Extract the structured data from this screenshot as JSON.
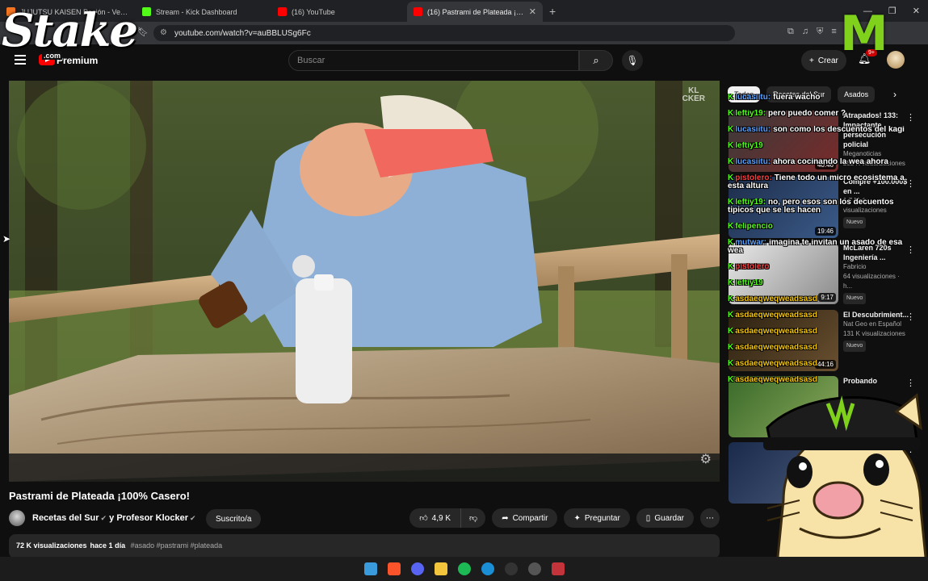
{
  "browser": {
    "tabs": [
      {
        "title": "JUJUTSU KAISEN Pasión - Ver en Crunchyroll",
        "color": "#f47521"
      },
      {
        "title": "Stream - Kick Dashboard",
        "color": "#53fc18"
      },
      {
        "title": "(16) YouTube",
        "color": "#ff0000"
      },
      {
        "title": "(16) Pastrami de Plateada ¡100% Casero! - YouTube",
        "color": "#ff0000"
      }
    ],
    "url": "youtube.com/watch?v=auBBLUSg6Fc",
    "new_tab": "+",
    "close": "✕"
  },
  "overlay": {
    "stake_logo": "Stake",
    "stake_com": ".com",
    "monster_logo": "M"
  },
  "header": {
    "premium_label": "Premium",
    "search_placeholder": "Buscar",
    "create_label": "Crear",
    "notifications_badge": "9+"
  },
  "video": {
    "title": "Pastrami de Plateada ¡100% Casero!",
    "watermark_line1": "KL",
    "watermark_line2": "CKER",
    "channel": "Recetas del Sur",
    "channel_joiner": "y",
    "channel2": "Profesor Klocker",
    "subscribe_label": "Suscrito/a",
    "likes": "4,9 K",
    "share_label": "Compartir",
    "ask_label": "Preguntar",
    "save_label": "Guardar",
    "views": "72 K visualizaciones",
    "age": "hace 1 día",
    "tags": "#asado #pastrami #plateada"
  },
  "sidebar": {
    "chips": [
      "Todos",
      "Recetas del Sur",
      "Asados"
    ],
    "recommendations": [
      {
        "title": "Atrapados! 133: Impactante persecución policial",
        "channel": "Meganoticias",
        "views": "252 K visualizaciones",
        "badge": "",
        "duration": "40:46",
        "thumb": "#7a2a2a"
      },
      {
        "title": "Compré +100.000$ en ...",
        "channel": "",
        "views": "1,7 M de visualizaciones",
        "badge": "Nuevo",
        "duration": "19:46",
        "thumb": "#3b5b8a"
      },
      {
        "title": "McLaren 720s Ingeniería ...",
        "channel": "Fabricio",
        "views": "64 visualizaciones · h...",
        "badge": "Nuevo",
        "duration": "9:17",
        "thumb": "#c7c7c7"
      },
      {
        "title": "El Descubrimient...",
        "channel": "Nat Geo en Español",
        "views": "131 K visualizaciones",
        "badge": "Nuevo",
        "duration": "44:16",
        "thumb": "#4a3a22"
      },
      {
        "title": "Probando",
        "channel": "",
        "views": "",
        "badge": "",
        "duration": "",
        "thumb": "#5a8a3a"
      }
    ]
  },
  "chat": [
    {
      "user": "lucasiitu",
      "color": "#5aa0ff",
      "text": "fuera wacho"
    },
    {
      "user": "leftiy19",
      "color": "#53fc18",
      "text": "pero puedo comer ?"
    },
    {
      "user": "lucasiitu",
      "color": "#5aa0ff",
      "text": "son como los descuentos del kagi"
    },
    {
      "user": "leftiy19",
      "color": "#53fc18",
      "text": ""
    },
    {
      "user": "lucasiitu",
      "color": "#5aa0ff",
      "text": "ahora cocinando la wea ahora"
    },
    {
      "user": "pistolero",
      "color": "#ff3b3b",
      "text": "Tiene todo un micro ecosistema a esta altura"
    },
    {
      "user": "leftiy19",
      "color": "#53fc18",
      "text": "no, pero esos son los decuentos tipicos que se les hacen"
    },
    {
      "user": "felipencio",
      "color": "#53fc18",
      "text": ""
    },
    {
      "user": "mutwar",
      "color": "#5aa0ff",
      "text": "imagina te invitan un asado de esa wea"
    },
    {
      "user": "pistolero",
      "color": "#ff3b3b",
      "text": ""
    },
    {
      "user": "leftiy19",
      "color": "#53fc18",
      "text": ""
    },
    {
      "user": "asdaeqweqweadsasd",
      "color": "#f5c400",
      "text": ""
    },
    {
      "user": "asdaeqweqweadsasd",
      "color": "#f5c400",
      "text": ""
    },
    {
      "user": "asdaeqweqweadsasd",
      "color": "#f5c400",
      "text": ""
    },
    {
      "user": "asdaeqweqweadsasd",
      "color": "#f5c400",
      "text": ""
    },
    {
      "user": "asdaeqweqweadsasd",
      "color": "#f5c400",
      "text": ""
    },
    {
      "user": "asdaeqweqweadsasd",
      "color": "#f5c400",
      "text": ""
    }
  ],
  "taskbar": [
    "windows-icon",
    "brave-icon",
    "discord-icon",
    "folder-icon",
    "spotify-icon",
    "edge-icon",
    "obs-icon",
    "app-icon",
    "vpn-icon"
  ]
}
